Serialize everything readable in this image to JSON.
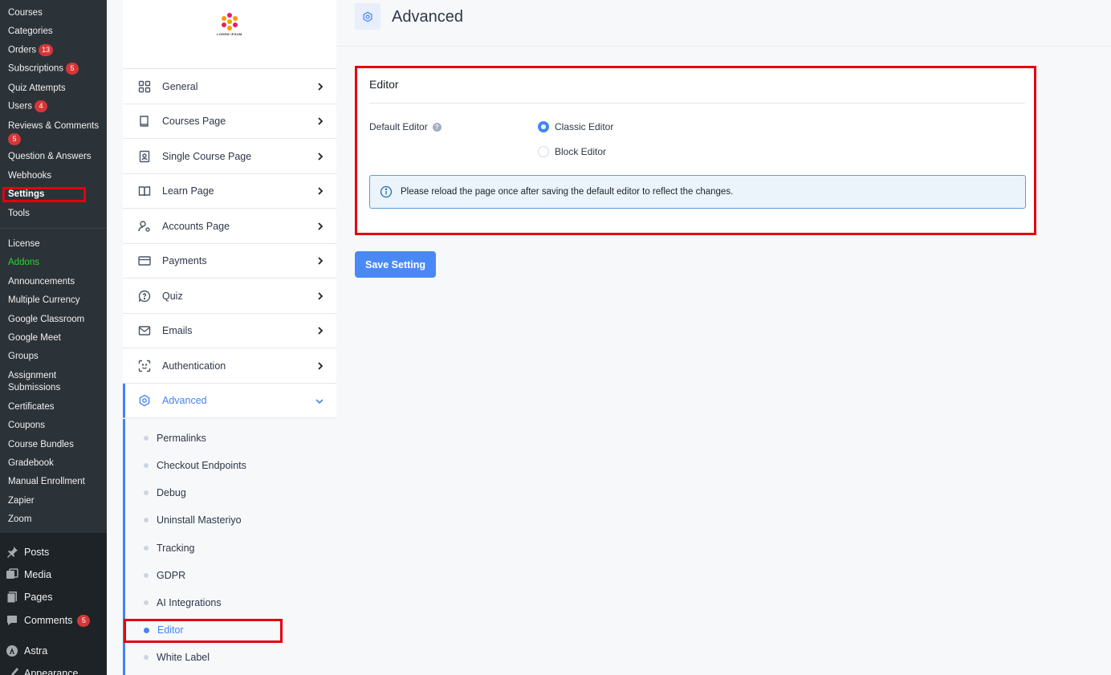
{
  "wp_submenu": [
    {
      "label": "Courses"
    },
    {
      "label": "Categories"
    },
    {
      "label": "Orders",
      "badge": "13"
    },
    {
      "label": "Subscriptions",
      "badge": "5"
    },
    {
      "label": "Quiz Attempts"
    },
    {
      "label": "Users",
      "badge": "4"
    },
    {
      "label": "Reviews & Comments",
      "badge": "5"
    },
    {
      "label": "Question & Answers"
    },
    {
      "label": "Webhooks"
    },
    {
      "label": "Settings"
    },
    {
      "label": "Tools"
    },
    {
      "label": "License"
    },
    {
      "label": "Addons"
    },
    {
      "label": "Announcements"
    },
    {
      "label": "Multiple Currency"
    },
    {
      "label": "Google Classroom"
    },
    {
      "label": "Google Meet"
    },
    {
      "label": "Groups"
    },
    {
      "label": "Assignment"
    },
    {
      "label": "Submissions"
    },
    {
      "label": "Certificates"
    },
    {
      "label": "Coupons"
    },
    {
      "label": "Course Bundles"
    },
    {
      "label": "Gradebook"
    },
    {
      "label": "Manual Enrollment"
    },
    {
      "label": "Zapier"
    },
    {
      "label": "Zoom"
    }
  ],
  "wp_mainmenu": [
    {
      "label": "Posts",
      "icon": "pin-icon"
    },
    {
      "label": "Media",
      "icon": "media-icon"
    },
    {
      "label": "Pages",
      "icon": "pages-icon"
    },
    {
      "label": "Comments",
      "icon": "comment-icon",
      "badge": "5"
    },
    {
      "label": "Astra",
      "icon": "astra-icon"
    },
    {
      "label": "Appearance",
      "icon": "brush-icon"
    }
  ],
  "logo": {
    "text": "LOREM IPSUM"
  },
  "settings_nav": [
    {
      "label": "General",
      "icon": "grid-icon"
    },
    {
      "label": "Courses Page",
      "icon": "book-icon"
    },
    {
      "label": "Single Course Page",
      "icon": "id-card-icon"
    },
    {
      "label": "Learn Page",
      "icon": "open-book-icon"
    },
    {
      "label": "Accounts Page",
      "icon": "user-gear-icon"
    },
    {
      "label": "Payments",
      "icon": "credit-card-icon"
    },
    {
      "label": "Quiz",
      "icon": "quiz-icon"
    },
    {
      "label": "Emails",
      "icon": "mail-icon"
    },
    {
      "label": "Authentication",
      "icon": "scan-face-icon"
    },
    {
      "label": "Advanced",
      "icon": "settings-icon"
    }
  ],
  "advanced_sub": [
    {
      "label": "Permalinks"
    },
    {
      "label": "Checkout Endpoints"
    },
    {
      "label": "Debug"
    },
    {
      "label": "Uninstall Masteriyo"
    },
    {
      "label": "Tracking"
    },
    {
      "label": "GDPR"
    },
    {
      "label": "AI Integrations"
    },
    {
      "label": "Editor"
    },
    {
      "label": "White Label"
    }
  ],
  "page": {
    "title": "Advanced",
    "card_title": "Editor",
    "field_label": "Default Editor",
    "help": "?",
    "options": [
      {
        "label": "Classic Editor",
        "checked": true
      },
      {
        "label": "Block Editor",
        "checked": false
      }
    ],
    "info_text": "Please reload the page once after saving the default editor to reflect the changes.",
    "save_label": "Save Setting"
  },
  "colors": {
    "accent": "#4285f4",
    "highlight": "#e3000f",
    "badge": "#d63638",
    "addons": "#2bd62b"
  }
}
